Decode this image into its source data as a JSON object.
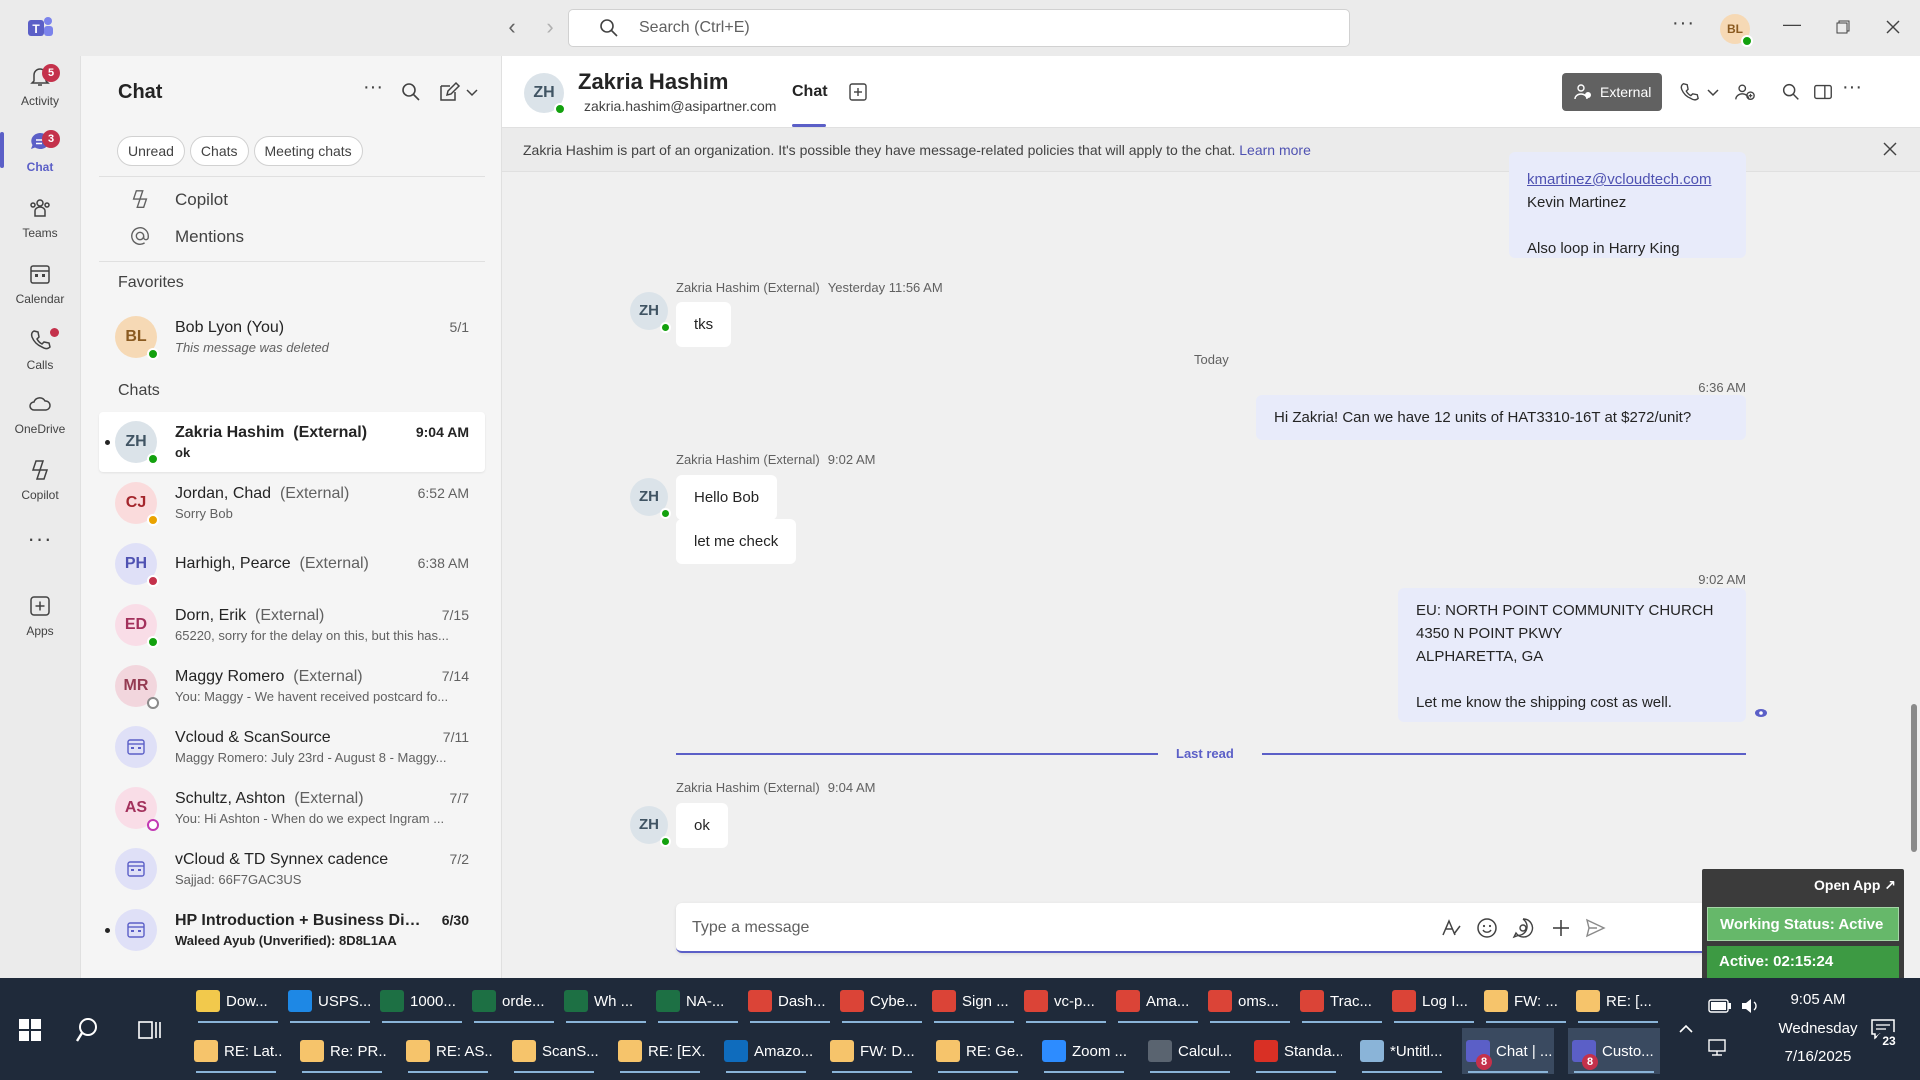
{
  "titlebar": {
    "search_placeholder": "Search (Ctrl+E)",
    "more": "···",
    "user_initials": "BL"
  },
  "rail": [
    {
      "label": "Activity",
      "badge": "5"
    },
    {
      "label": "Chat",
      "badge": "3"
    },
    {
      "label": "Teams"
    },
    {
      "label": "Calendar"
    },
    {
      "label": "Calls"
    },
    {
      "label": "OneDrive"
    },
    {
      "label": "Copilot"
    },
    {
      "label": "···"
    },
    {
      "label": "Apps"
    }
  ],
  "chatlist": {
    "title": "Chat",
    "filters": [
      "Unread",
      "Chats",
      "Meeting chats"
    ],
    "links": [
      "Copilot",
      "Mentions"
    ],
    "favorites_label": "Favorites",
    "chats_label": "Chats",
    "favorites": [
      {
        "initials": "BL",
        "name": "Bob Lyon (You)",
        "ext": "",
        "preview": "This message was deleted",
        "time": "5/1"
      }
    ],
    "chats": [
      {
        "initials": "ZH",
        "name": "Zakria Hashim",
        "ext": "(External)",
        "preview": "ok",
        "time": "9:04 AM"
      },
      {
        "initials": "CJ",
        "name": "Jordan, Chad",
        "ext": "(External)",
        "preview": "Sorry Bob",
        "time": "6:52 AM"
      },
      {
        "initials": "PH",
        "name": "Harhigh, Pearce",
        "ext": "(External)",
        "preview": "",
        "time": "6:38 AM"
      },
      {
        "initials": "ED",
        "name": "Dorn, Erik",
        "ext": "(External)",
        "preview": "65220, sorry for the delay on this, but this has...",
        "time": "7/15"
      },
      {
        "initials": "MR",
        "name": "Maggy Romero",
        "ext": "(External)",
        "preview": "You: Maggy - We havent received postcard fo...",
        "time": "7/14"
      },
      {
        "initials": "",
        "name": "Vcloud & ScanSource",
        "ext": "",
        "preview": "Maggy Romero: July 23rd - August 8 - Maggy...",
        "time": "7/11"
      },
      {
        "initials": "AS",
        "name": "Schultz, Ashton",
        "ext": "(External)",
        "preview": "You: Hi Ashton -  When do we expect Ingram ...",
        "time": "7/7"
      },
      {
        "initials": "",
        "name": "vCloud & TD Synnex cadence",
        "ext": "",
        "preview": "Sajjad: 66F7GAC3US",
        "time": "7/2"
      },
      {
        "initials": "",
        "name": "HP Introduction + Business Dis...",
        "ext": "",
        "preview": "Waleed Ayub (Unverified): 8D8L1AA",
        "time": "6/30"
      }
    ]
  },
  "header": {
    "initials": "ZH",
    "name": "Zakria Hashim",
    "email": "zakria.hashim@asipartner.com",
    "tab": "Chat",
    "external_label": "External"
  },
  "banner": {
    "text": "Zakria Hashim is part of an organization. It's possible they have message-related policies that will apply to the chat.",
    "link": "Learn more"
  },
  "messages": {
    "top_bubble": {
      "link": "kmartinez@vcloudtech.com",
      "line1": "Kevin Martinez",
      "line2": "Also loop in Harry King"
    },
    "m1": {
      "sender": "Zakria Hashim (External)",
      "time": "Yesterday 11:56 AM",
      "text": "tks"
    },
    "day_label": "Today",
    "o1": {
      "time": "6:36 AM",
      "text": "Hi Zakria! Can we have 12 units of HAT3310-16T at $272/unit?"
    },
    "m2": {
      "sender": "Zakria Hashim (External)",
      "time": "9:02 AM",
      "text1": "Hello Bob",
      "text2": "let me check"
    },
    "o2": {
      "time": "9:02 AM",
      "line1": "EU: NORTH POINT COMMUNITY CHURCH",
      "line2": "4350 N POINT PKWY",
      "line3": "ALPHARETTA, GA",
      "line4": "Let me know the shipping cost as well."
    },
    "last_read": "Last read",
    "m3": {
      "sender": "Zakria Hashim (External)",
      "time": "9:04 AM",
      "text": "ok"
    }
  },
  "compose": {
    "placeholder": "Type a message"
  },
  "widget": {
    "open_app": "Open App ↗",
    "status": "Working Status: Active",
    "active": "Active: 02:15:24"
  },
  "taskbar": {
    "row1": [
      {
        "label": "Dow...",
        "color": "#f2c94c"
      },
      {
        "label": "USPS...",
        "color": "#1e88e5"
      },
      {
        "label": "1000...",
        "color": "#1d7044"
      },
      {
        "label": "orde...",
        "color": "#1d7044"
      },
      {
        "label": "Wh ...",
        "color": "#1d7044"
      },
      {
        "label": "NA-...",
        "color": "#1d7044"
      },
      {
        "label": "Dash...",
        "color": "#db4437"
      },
      {
        "label": "Cybe...",
        "color": "#db4437"
      },
      {
        "label": "Sign ...",
        "color": "#db4437"
      },
      {
        "label": "vc-p...",
        "color": "#db4437"
      },
      {
        "label": "Ama...",
        "color": "#db4437"
      },
      {
        "label": "oms...",
        "color": "#db4437"
      },
      {
        "label": "Trac...",
        "color": "#db4437"
      },
      {
        "label": "Log I...",
        "color": "#db4437"
      },
      {
        "label": "FW: ...",
        "color": "#f6c46b"
      },
      {
        "label": "RE: [...",
        "color": "#f6c46b"
      }
    ],
    "row2": [
      {
        "label": "RE: Lat...",
        "color": "#f6c46b"
      },
      {
        "label": "Re: PR...",
        "color": "#f6c46b"
      },
      {
        "label": "RE: AS...",
        "color": "#f6c46b"
      },
      {
        "label": "ScanS...",
        "color": "#f6c46b"
      },
      {
        "label": "RE: [EX...",
        "color": "#f6c46b"
      },
      {
        "label": "Amazo...",
        "color": "#0f6cbd"
      },
      {
        "label": "FW: D...",
        "color": "#f6c46b"
      },
      {
        "label": "RE: Ge...",
        "color": "#f6c46b"
      },
      {
        "label": "Zoom ...",
        "color": "#2d8cff"
      },
      {
        "label": "Calcul...",
        "color": "#5a6470"
      },
      {
        "label": "Standa...",
        "color": "#d93025"
      },
      {
        "label": "*Untitl...",
        "color": "#8ab4d8"
      },
      {
        "label": "Chat | ...",
        "color": "#5b5fc7",
        "badge": "8"
      },
      {
        "label": "Custo...",
        "color": "#5b5fc7",
        "badge": "8"
      }
    ],
    "time": "9:05 AM",
    "day": "Wednesday",
    "date": "7/16/2025",
    "notif_count": "23"
  }
}
